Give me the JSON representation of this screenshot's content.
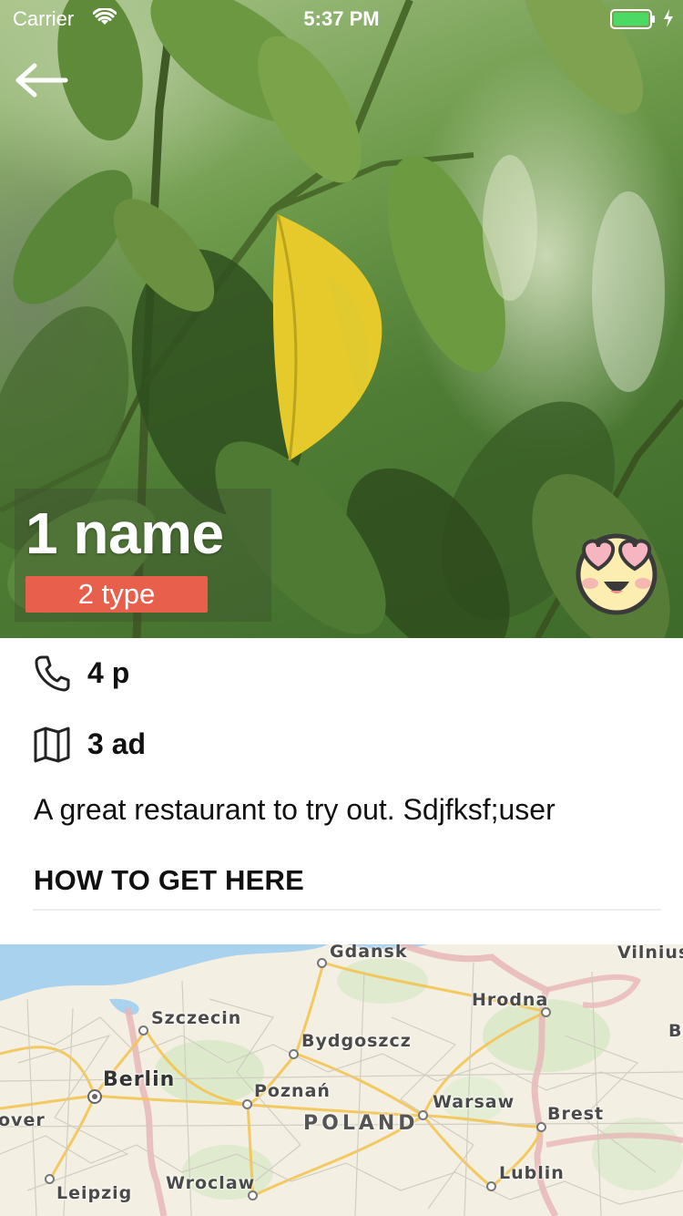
{
  "status_bar": {
    "carrier": "Carrier",
    "time": "5:37 PM",
    "battery_color": "#4cd964"
  },
  "header": {
    "back_icon": "arrow-left-icon"
  },
  "place": {
    "name": "1 name",
    "type": "2 type",
    "type_badge_color": "#e8604c",
    "reaction_icon": "heart-eyes-emoji-icon"
  },
  "details": {
    "phone_icon": "phone-icon",
    "phone": "4 p",
    "address_icon": "map-icon",
    "address": "3 ad",
    "description": "A great restaurant to try out. Sdjfksf;user",
    "directions_heading": "HOW TO GET HERE"
  },
  "map": {
    "country": "POLAND",
    "cities": [
      "Gdansk",
      "Vilnius",
      "Hrodna",
      "Szczecin",
      "Bydgoszcz",
      "B",
      "Berlin",
      "Poznań",
      "Warsaw",
      "Brest",
      "over",
      "Lublin",
      "Wroclaw",
      "Leipzig"
    ]
  }
}
